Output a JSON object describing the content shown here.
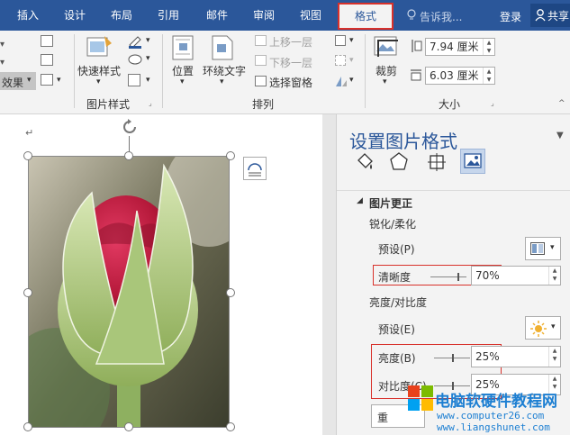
{
  "tabs": [
    {
      "label": "插入"
    },
    {
      "label": "设计"
    },
    {
      "label": "布局"
    },
    {
      "label": "引用"
    },
    {
      "label": "邮件"
    },
    {
      "label": "审阅"
    },
    {
      "label": "视图"
    },
    {
      "label": "格式"
    }
  ],
  "tellme": "告诉我...",
  "login": "登录",
  "share": "共享",
  "ribbon": {
    "effects_label": "效果",
    "quick_styles": "快速样式",
    "picture_styles_group": "图片样式",
    "position": "位置",
    "wrap_text": "环绕文字",
    "bring_forward": "上移一层",
    "send_backward": "下移一层",
    "selection_pane": "选择窗格",
    "arrange_group": "排列",
    "crop": "裁剪",
    "height_value": "7.94 厘米",
    "width_value": "6.03 厘米",
    "size_group": "大小"
  },
  "document": {
    "paragraph_mark": "↵"
  },
  "pane": {
    "title": "设置图片格式",
    "section": "图片更正",
    "sharpen_header": "锐化/柔化",
    "preset1_label": "预设(P)",
    "clarity_label": "清晰度",
    "clarity_value": "70%",
    "brightness_header": "亮度/对比度",
    "preset2_label": "预设(E)",
    "brightness_label": "亮度(B)",
    "brightness_value": "25%",
    "contrast_label": "对比度(C)",
    "contrast_value": "25%",
    "reset_label": "重"
  },
  "watermark": {
    "site_name": "电脑软硬件教程网",
    "url1": "www.computer26.com",
    "url2": "www.liangshunet.com"
  },
  "colors": {
    "tabbar": "#2b579a",
    "highlight": "#d8312b",
    "rose": "#b5193a",
    "leaf": "#9cbf6e"
  }
}
